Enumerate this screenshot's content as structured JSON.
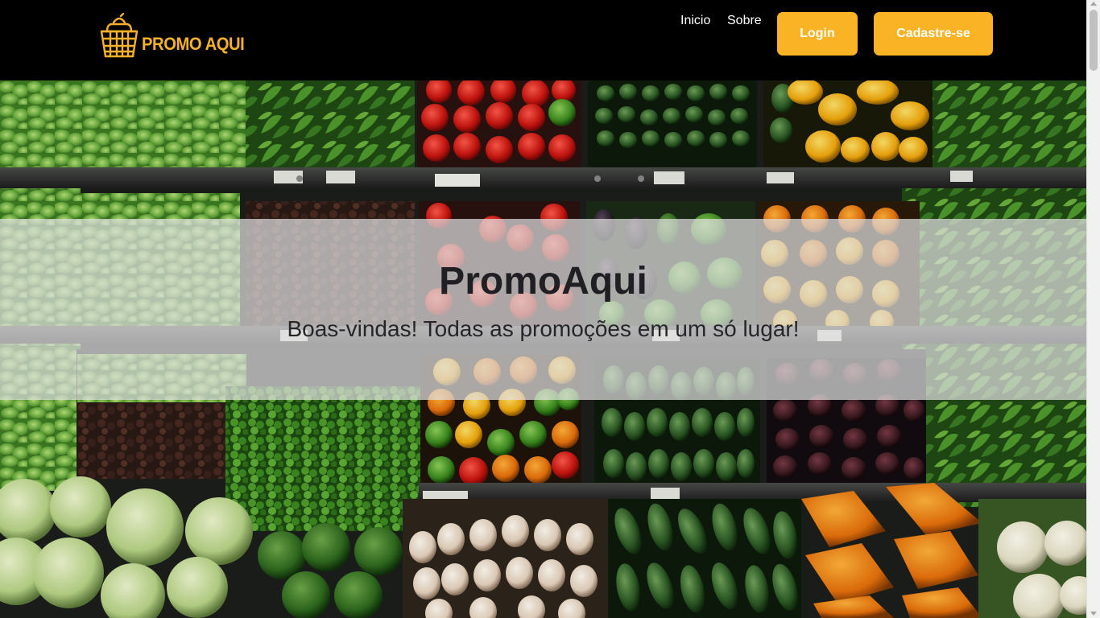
{
  "header": {
    "logo_text": "PROMO AQUI",
    "logo_icon": "shopping-basket-icon",
    "nav": {
      "inicio": "Inicio",
      "sobre": "Sobre"
    },
    "login_label": "Login",
    "cadastro_label": "Cadastre-se"
  },
  "banner": {
    "title": "PromoAqui",
    "subtitle": "Boas-vindas! Todas as promoções em um só lugar!"
  },
  "colors": {
    "accent": "#fbb326",
    "header_bg": "#000000",
    "banner_overlay": "rgba(225,225,225,0.72)"
  }
}
